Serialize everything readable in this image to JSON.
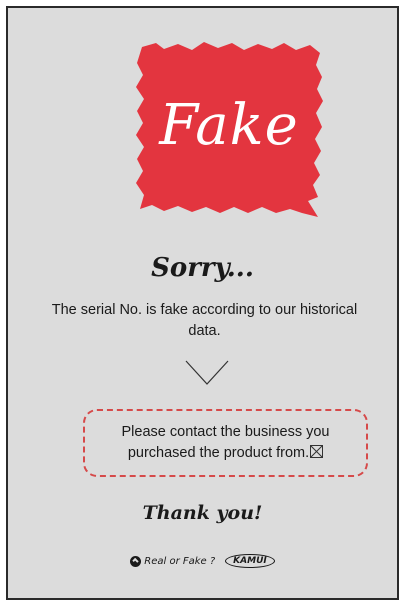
{
  "stamp": {
    "label": "Fake",
    "color": "#e3353f"
  },
  "result": {
    "heading": "Sorry...",
    "message": "The serial No. is fake according to our historical data."
  },
  "notice": {
    "text": "Please contact the business you purchased the product from."
  },
  "closing": "Thank you!",
  "footer": {
    "brand_left": "Real or Fake ?",
    "brand_right": "KAMUI"
  },
  "colors": {
    "background": "#dcdcdc",
    "accent_red": "#e3353f",
    "dashed_border": "#d64a4a"
  }
}
